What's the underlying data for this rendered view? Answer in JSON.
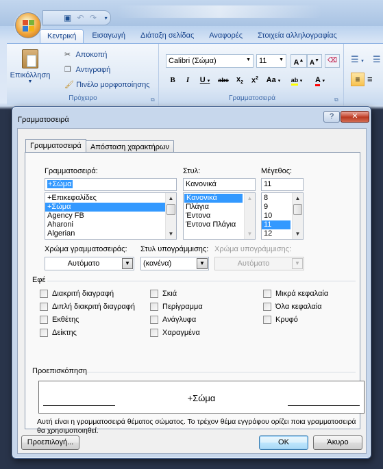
{
  "ribbon": {
    "tabs": [
      "Κεντρική",
      "Εισαγωγή",
      "Διάταξη σελίδας",
      "Αναφορές",
      "Στοιχεία αλληλογραφίας"
    ],
    "active_tab": "Κεντρική",
    "clipboard": {
      "paste_label": "Επικόλληση",
      "cut_label": "Αποκοπή",
      "copy_label": "Αντιγραφή",
      "format_painter_label": "Πινέλο μορφοποίησης",
      "group_label": "Πρόχειρο"
    },
    "font_group": {
      "font_name": "Calibri (Σώμα)",
      "font_size": "11",
      "group_label": "Γραμματοσειρά"
    },
    "colors": {
      "highlight": "#ffff00",
      "font_color": "#ff0000"
    }
  },
  "dialog": {
    "title": "Γραμματοσειρά",
    "help_label": "?",
    "close_label": "✕",
    "tabs": [
      "Γραμματοσειρά",
      "Απόσταση χαρακτήρων"
    ],
    "active_tab": "Γραμματοσειρά",
    "font": {
      "label": "Γραμματοσειρά:",
      "value": "+Σώμα",
      "options": [
        "+Επικεφαλίδες",
        "+Σώμα",
        "Agency FB",
        "Aharoni",
        "Algerian"
      ],
      "selected": "+Σώμα"
    },
    "style": {
      "label": "Στυλ:",
      "value": "Κανονικά",
      "options": [
        "Κανονικά",
        "Πλάγια",
        "Έντονα",
        "Έντονα Πλάγια"
      ],
      "selected": "Κανονικά"
    },
    "size": {
      "label": "Μέγεθος:",
      "value": "11",
      "options": [
        "8",
        "9",
        "10",
        "11",
        "12"
      ],
      "selected": "11"
    },
    "font_color": {
      "label": "Χρώμα γραμματοσειράς:",
      "value": "Αυτόματο"
    },
    "underline_style": {
      "label": "Στυλ υπογράμμισης:",
      "value": "(κανένα)"
    },
    "underline_color": {
      "label": "Χρώμα υπογράμμισης:",
      "value": "Αυτόματο"
    },
    "effects": {
      "label": "Εφέ",
      "col1": [
        "Διακριτή διαγραφή",
        "Διπλή διακριτή διαγραφή",
        "Εκθέτης",
        "Δείκτης"
      ],
      "col2": [
        "Σκιά",
        "Περίγραμμα",
        "Ανάγλυφα",
        "Χαραγμένα"
      ],
      "col3": [
        "Μικρά κεφαλαία",
        "Όλα κεφαλαία",
        "Κρυφό"
      ]
    },
    "preview": {
      "label": "Προεπισκόπηση",
      "text": "+Σώμα",
      "description": "Αυτή είναι η γραμματοσειρά θέματος σώματος. Το τρέχον θέμα εγγράφου ορίζει ποια γραμματοσειρά θα χρησιμοποιηθεί."
    },
    "buttons": {
      "default_label": "Προεπιλογή...",
      "ok_label": "OK",
      "cancel_label": "Άκυρο"
    }
  }
}
